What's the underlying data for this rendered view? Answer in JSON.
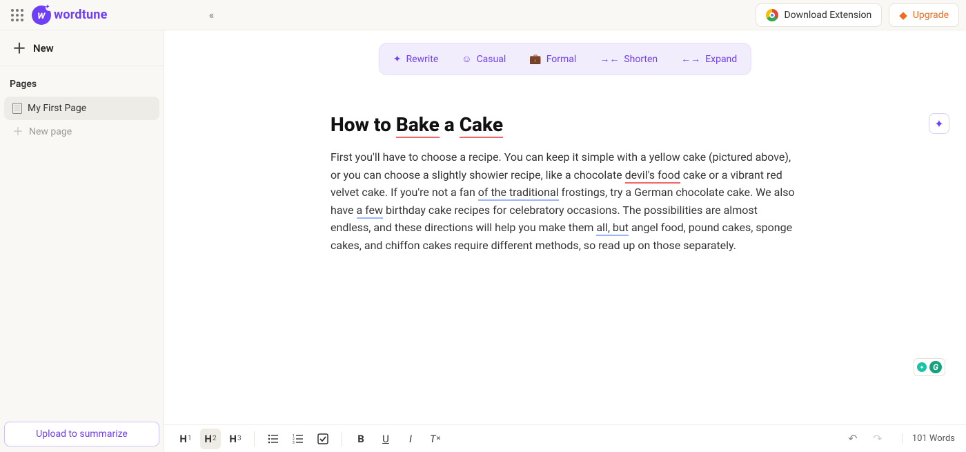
{
  "header": {
    "brand": "wordtune",
    "download_label": "Download Extension",
    "upgrade_label": "Upgrade"
  },
  "sidebar": {
    "new_label": "New",
    "section_label": "Pages",
    "pages": [
      {
        "label": "My First Page",
        "active": true
      }
    ],
    "new_page_label": "New page",
    "upload_label": "Upload to summarize"
  },
  "actions": {
    "rewrite": "Rewrite",
    "casual": "Casual",
    "formal": "Formal",
    "shorten": "Shorten",
    "expand": "Expand"
  },
  "document": {
    "title_pre": "How to ",
    "title_w1": "Bake",
    "title_mid": " a ",
    "title_w2": "Cake",
    "body_1": "First you'll have to choose a recipe. You can keep it simple with a yellow cake (pictured above), or you can choose a slightly showier recipe, like a chocolate ",
    "body_ul1": "devil's food",
    "body_2": " cake or a vibrant red velvet cake. If you're not a fan ",
    "body_ul2": "of the traditional",
    "body_3": " frostings, try a German chocolate cake. We also have ",
    "body_ul3": "a few",
    "body_4": " birthday cake recipes for celebratory occasions. The possibilities are almost endless, and these directions will help you make them ",
    "body_ul4": "all, but",
    "body_5": " angel food, pound cakes, sponge cakes, and chiffon cakes require different methods, so read up on those separately."
  },
  "bottombar": {
    "h1": "H",
    "h1s": "1",
    "h2": "H",
    "h2s": "2",
    "h3": "H",
    "h3s": "3",
    "word_count": "101 Words"
  }
}
